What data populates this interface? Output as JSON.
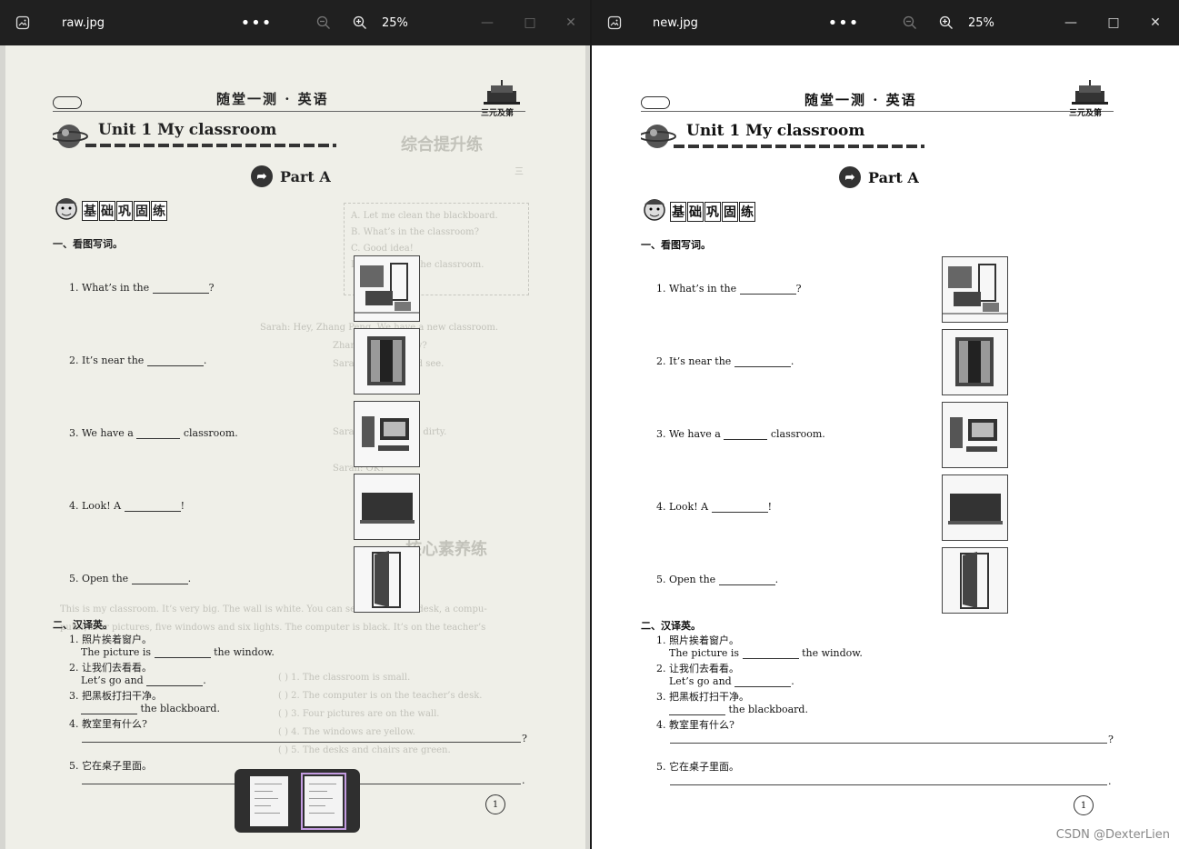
{
  "left_window": {
    "file_name": "raw.jpg",
    "more_label": "•••",
    "zoom": "25%",
    "thumbnails_count": 2,
    "selected_thumbnail": 2
  },
  "right_window": {
    "file_name": "new.jpg",
    "more_label": "•••",
    "zoom": "25%"
  },
  "icons": {
    "app": "image-icon",
    "more": "more-icon",
    "zoom_out": "zoom-out-icon",
    "zoom_in": "zoom-in-icon",
    "minimize": "minimize-icon",
    "maximize": "maximize-icon",
    "close": "close-icon"
  },
  "worksheet": {
    "header_title": "随堂一测 · 英语",
    "logo_text": "三元及第",
    "unit_title": "Unit 1    My classroom",
    "part_title": "Part A",
    "banner_chars": [
      "基",
      "础",
      "巩",
      "固",
      "练"
    ],
    "section1_title": "一、看图写词。",
    "section1_items": [
      {
        "pre": "1. What’s in the",
        "post": "?"
      },
      {
        "pre": "2. It’s near the",
        "post": "."
      },
      {
        "pre": "3. We have a",
        "post": "classroom."
      },
      {
        "pre": "4. Look! A",
        "post": "!"
      },
      {
        "pre": "5. Open the",
        "post": "."
      }
    ],
    "section2_title": "二、汉译英。",
    "section2_items": [
      {
        "cn": "1. 照片挨着窗户。",
        "en_pre": "The picture is",
        "en_post": "the window."
      },
      {
        "cn": "2. 让我们去看看。",
        "en_pre": "Let’s go and",
        "en_post": "."
      },
      {
        "cn": "3. 把黑板打扫干净。",
        "en_pre": "",
        "en_post": "the blackboard."
      },
      {
        "cn": "4. 教室里有什么?",
        "end": "?"
      },
      {
        "cn": "5. 它在桌子里面。",
        "end": "."
      }
    ],
    "page_number": "1"
  },
  "watermark": "CSDN @DexterLien",
  "colors": {
    "titlebar": "#202020",
    "left_page": "#efefe8",
    "right_page": "#ffffff",
    "thumb_selected": "#c39be0"
  }
}
